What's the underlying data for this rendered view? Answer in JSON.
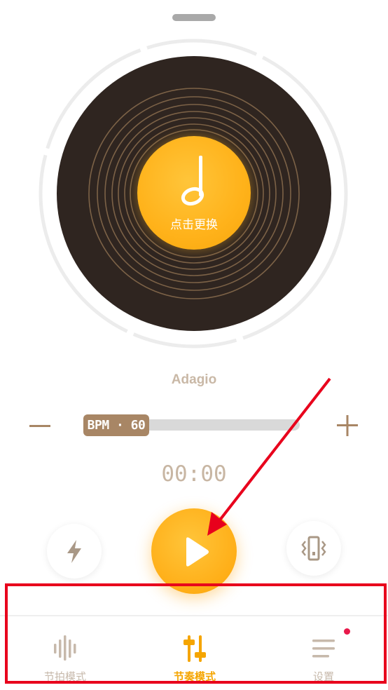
{
  "record": {
    "label_text": "点击更换",
    "icon": "music-note-icon"
  },
  "tempo": {
    "name": "Adagio",
    "bpm_label": "BPM · 60",
    "bpm": 60
  },
  "timer": {
    "value": "00:00"
  },
  "controls": {
    "minus_icon": "minus-icon",
    "plus_icon": "plus-icon",
    "flash_icon": "lightning-icon",
    "vibrate_icon": "vibrate-icon",
    "play_icon": "play-icon"
  },
  "tabbar": {
    "items": [
      {
        "label": "节拍模式",
        "icon": "beat-bars-icon",
        "active": false
      },
      {
        "label": "节奏模式",
        "icon": "sliders-icon",
        "active": true
      },
      {
        "label": "设置",
        "icon": "menu-icon",
        "active": false,
        "badge": true
      }
    ]
  },
  "colors": {
    "accent": "#FFB21A",
    "brown": "#A88665",
    "disc": "#2F2520",
    "annotation": "#E8001C"
  }
}
